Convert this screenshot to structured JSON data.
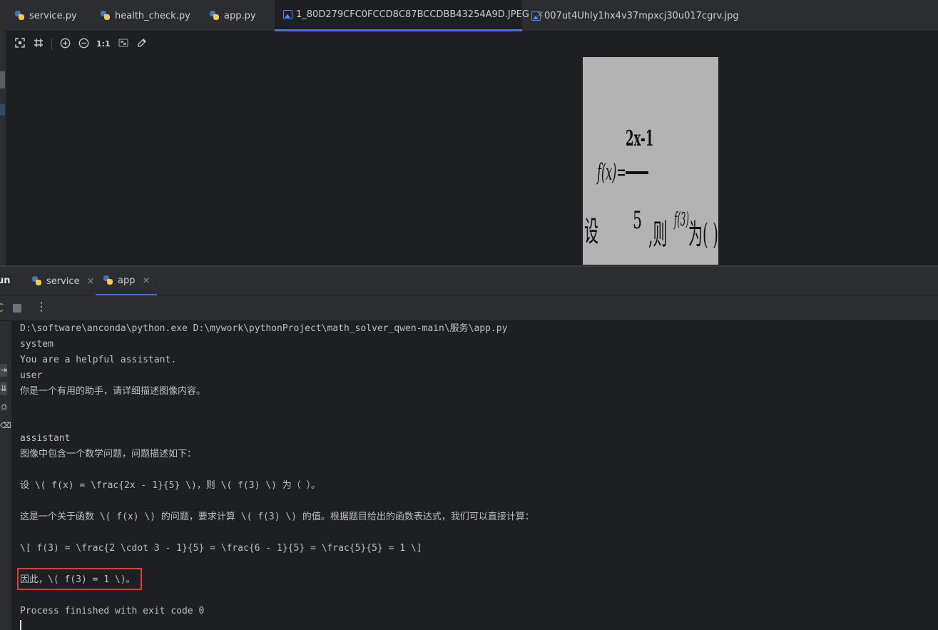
{
  "editor_tabs": [
    {
      "label": "service.py",
      "icon": "python-file-icon"
    },
    {
      "label": "health_check.py",
      "icon": "python-file-icon"
    },
    {
      "label": "app.py",
      "icon": "python-file-icon"
    },
    {
      "label": "1_80D279CFC0FCCD8C87BCCDBB43254A9D.JPEG",
      "icon": "image-file-icon",
      "active": true,
      "close": "×"
    },
    {
      "label": "007ut4Uhly1hx4v37mpxcj30u017cgrv.jpg",
      "icon": "image-file-icon"
    }
  ],
  "viewer_toolbar": {
    "fit_icon": "fit-to-window-icon",
    "grid_icon": "grid-icon",
    "zoom_in_icon": "zoom-in-icon",
    "zoom_out_icon": "zoom-out-icon",
    "actual_size": "1:1",
    "background_icon": "chessboard-icon",
    "color_picker_icon": "color-picker-icon"
  },
  "image_content": {
    "numerator": "2x-1",
    "function": "f(x)=",
    "denominator": "5",
    "prefix": "设",
    "suffix": ",则",
    "f3": "f(3)",
    "ending": "为(  )"
  },
  "run_panel": {
    "title": "un",
    "tabs": [
      {
        "label": "service",
        "close": "×"
      },
      {
        "label": "app",
        "close": "×",
        "active": true
      }
    ],
    "more": "⋮"
  },
  "console": {
    "lines": [
      "D:\\software\\anconda\\python.exe D:\\mywork\\pythonProject\\math_solver_qwen-main\\服务\\app.py",
      "system",
      "You are a helpful assistant.",
      "user",
      "你是一个有用的助手，请详细描述图像内容。",
      "",
      "",
      "assistant",
      "图像中包含一个数学问题，问题描述如下：",
      "",
      "设 \\( f(x) = \\frac{2x - 1}{5} \\)，则 \\( f(3) \\) 为（ ）。",
      "",
      "这是一个关于函数 \\( f(x) \\) 的问题，要求计算 \\( f(3) \\) 的值。根据题目给出的函数表达式，我们可以直接计算：",
      "",
      "\\[ f(3) = \\frac{2 \\cdot 3 - 1}{5} = \\frac{6 - 1}{5} = \\frac{5}{5} = 1 \\]",
      "",
      "因此，\\( f(3) = 1 \\)。",
      "",
      "Process finished with exit code 0"
    ]
  },
  "colors": {
    "highlight": "#e03a3a",
    "accent": "#3574f0"
  }
}
